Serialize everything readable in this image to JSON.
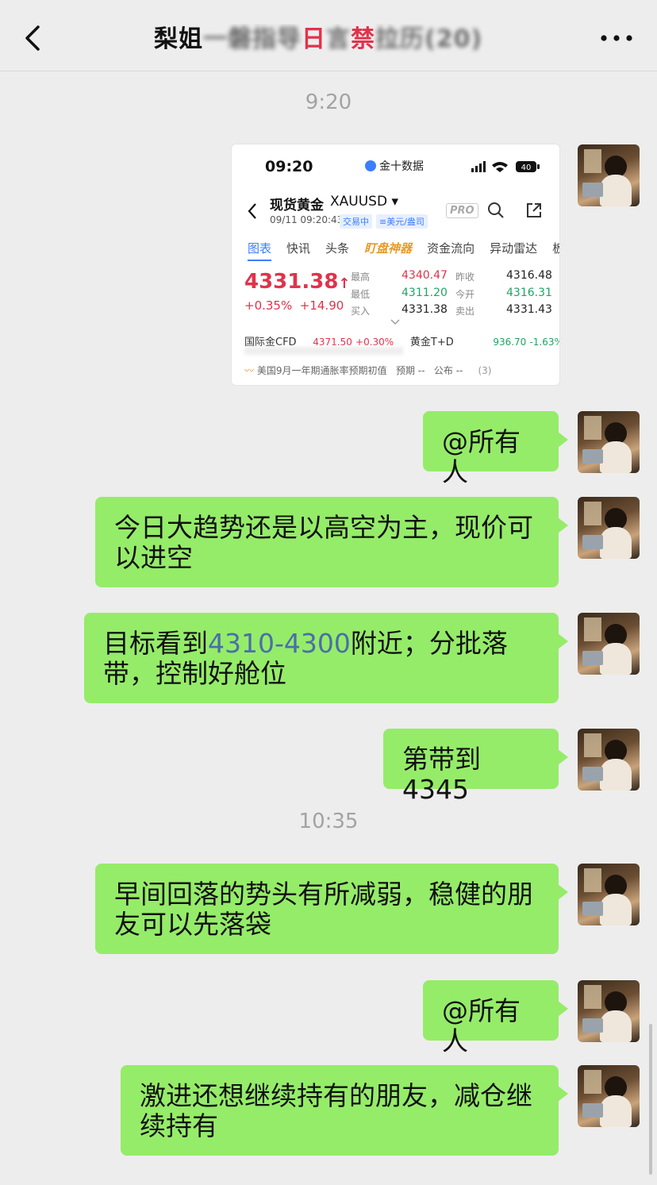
{
  "header": {
    "title_part1": "梨姐",
    "title_blurred": "一磐指导",
    "title_part2": "日",
    "title_blurred2": "言",
    "title_part3": "禁",
    "title_tail": "拉历(20)"
  },
  "messages": [
    {
      "type": "time",
      "text": "9:20"
    },
    {
      "type": "image"
    },
    {
      "type": "text",
      "text": "@所有人"
    },
    {
      "type": "text",
      "text": "今日大趋势还是以高空为主，现价可以进空"
    },
    {
      "type": "text",
      "pre": "目标看到",
      "highlight": "4310-4300",
      "post": "附近；分批落带，控制好舱位"
    },
    {
      "type": "text",
      "text": "第带到4345"
    },
    {
      "type": "time",
      "text": "10:35"
    },
    {
      "type": "text",
      "text": "早间回落的势头有所减弱，稳健的朋友可以先落袋"
    },
    {
      "type": "text",
      "text": "@所有人"
    },
    {
      "type": "text",
      "text": "激进还想继续持有的朋友，减仓继续持有"
    }
  ],
  "image_card": {
    "status_time": "09:20",
    "app_name": "金十数据",
    "battery": "40",
    "symbol_name": "现货黄金",
    "symbol_code": "XAUUSD ▾",
    "timestamp": "09/11 09:20:43",
    "tag_trading": "交易中",
    "tag_unit": "≡美元/盎司",
    "pro": "PRO",
    "tabs": [
      "图表",
      "快讯",
      "头条",
      "盯盘神器",
      "资金流向",
      "异动雷达",
      "板"
    ],
    "price": "4331.38",
    "price_arrow": "↑",
    "change_pct": "+0.35%",
    "change_abs": "+14.90",
    "quotes": {
      "high_label": "最高",
      "high": "4340.47",
      "low_label": "最低",
      "low": "4311.20",
      "buy_label": "买入",
      "buy": "4331.38",
      "prev_label": "昨收",
      "prev": "4316.48",
      "open_label": "今开",
      "open": "4316.31",
      "sell_label": "卖出",
      "sell": "4331.43"
    },
    "cfd_label": "国际金CFD",
    "cfd_value": "4371.50",
    "cfd_change": "+0.30%",
    "td_label": "黄金T+D",
    "td_value": "936.70",
    "td_change": "-1.63%",
    "news_text": "美国9月一年期通胀率预期初值",
    "news_expected": "预期 --",
    "news_published": "公布 --",
    "news_count": "(3)"
  },
  "colors": {
    "bubble": "#95ec69",
    "background": "#ededed",
    "price_up": "#e0334b",
    "price_down": "#21a465",
    "accent": "#3d7dff"
  }
}
